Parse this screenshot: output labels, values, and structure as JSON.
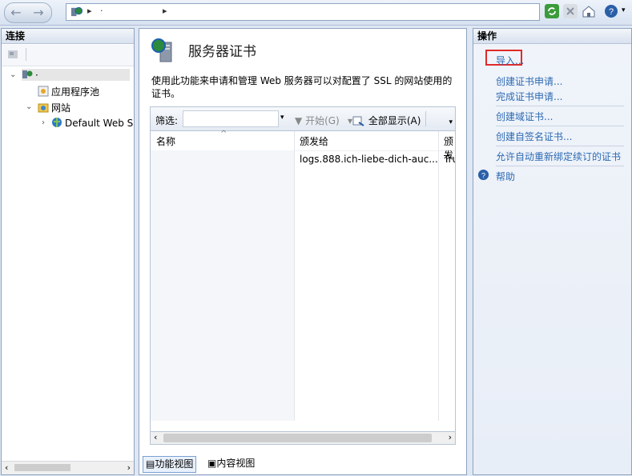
{
  "address_bar": {
    "crumb": "·"
  },
  "connections": {
    "title": "连接",
    "server_node": "·",
    "app_pools": "应用程序池",
    "sites": "网站",
    "default_site": "Default Web S"
  },
  "center": {
    "title": "服务器证书",
    "description": "使用此功能来申请和管理 Web 服务器可以对配置了 SSL 的网站使用的证书。",
    "filter_label": "筛选:",
    "start_label": "开始(G)",
    "show_all_label": "全部显示(A)",
    "columns": [
      "名称",
      "颁发给",
      "颁发"
    ],
    "rows": [
      {
        "name": "",
        "issued_to": "logs.888.ich-liebe-dich-auc...",
        "issued_by": "Tru"
      }
    ],
    "view_tabs": [
      "功能视图",
      "内容视图"
    ]
  },
  "actions": {
    "title": "操作",
    "items": [
      "导入...",
      "创建证书申请...",
      "完成证书申请...",
      "创建域证书...",
      "创建自签名证书...",
      "允许自动重新绑定续订的证书",
      "帮助"
    ]
  },
  "colors": {
    "link": "#2d6ab2",
    "highlight": "#e02a2a",
    "header_bg": "#d8e1ee"
  }
}
